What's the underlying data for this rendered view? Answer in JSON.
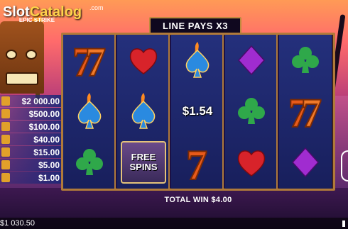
{
  "watermark": {
    "part1": "Slot",
    "part2": "Catalog",
    "suffix": ".com"
  },
  "game_logo": {
    "text": "EPIC STRIKE"
  },
  "banner": {
    "line_pays": "LINE PAYS X3"
  },
  "paytable": {
    "rows": [
      "$2 000.00",
      "$500.00",
      "$100.00",
      "$40.00",
      "$15.00",
      "$5.00",
      "$1.00"
    ]
  },
  "reels": [
    [
      {
        "symbol": "seven"
      },
      {
        "symbol": "spade-fire"
      },
      {
        "symbol": "club"
      }
    ],
    [
      {
        "symbol": "heart"
      },
      {
        "symbol": "spade-fire"
      },
      {
        "symbol": "free-spins"
      }
    ],
    [
      {
        "symbol": "spade-fire"
      },
      {
        "symbol": "win-amount"
      },
      {
        "symbol": "seven"
      }
    ],
    [
      {
        "symbol": "diamond"
      },
      {
        "symbol": "club"
      },
      {
        "symbol": "heart"
      }
    ],
    [
      {
        "symbol": "club"
      },
      {
        "symbol": "seven"
      },
      {
        "symbol": "diamond"
      }
    ]
  ],
  "free_spins": {
    "line1": "FREE",
    "line2": "SPINS"
  },
  "win_amount": "$1.54",
  "total_win": "TOTAL WIN $4.00",
  "balance": "$1 030.50",
  "colors": {
    "frame": "#b07a3a",
    "reel_bg": "#24307c",
    "heart": "#d8232a",
    "club": "#2fa84a",
    "diamond": "#a02cd0",
    "spade": "#2a8ae0",
    "seven": "#e85a1a"
  }
}
